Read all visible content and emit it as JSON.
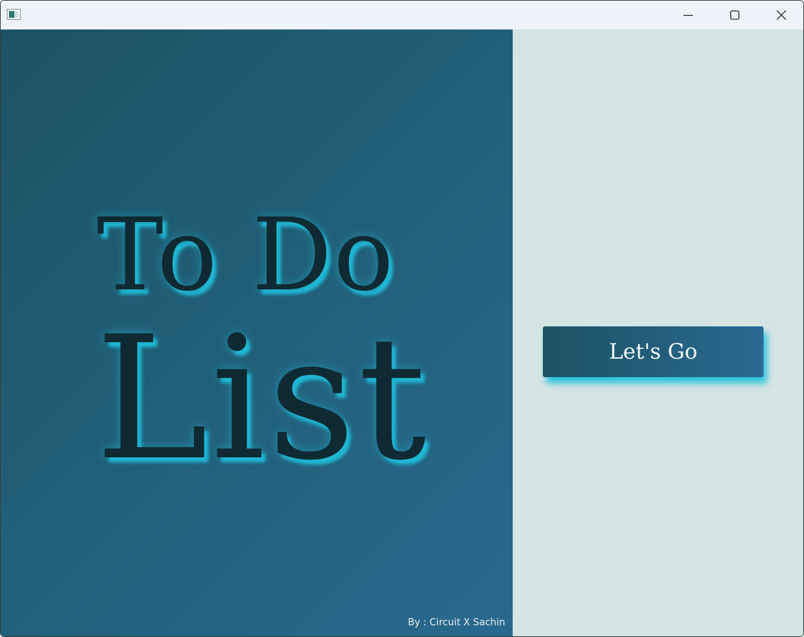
{
  "window": {
    "app_icon": "app-window-icon",
    "controls": {
      "minimize_icon": "minimize-icon",
      "maximize_icon": "maximize-icon",
      "close_icon": "close-icon"
    }
  },
  "hero": {
    "title_line1": "To Do",
    "title_line2": "List",
    "credit": "By : Circuit X Sachin"
  },
  "action": {
    "button_label": "Let's Go"
  },
  "colors": {
    "left_gradient_start": "#1b5363",
    "left_gradient_end": "#29698f",
    "right_panel": "#d5e4e4",
    "glow_accent": "#1fb8d4",
    "title_text": "#0f2a33"
  }
}
